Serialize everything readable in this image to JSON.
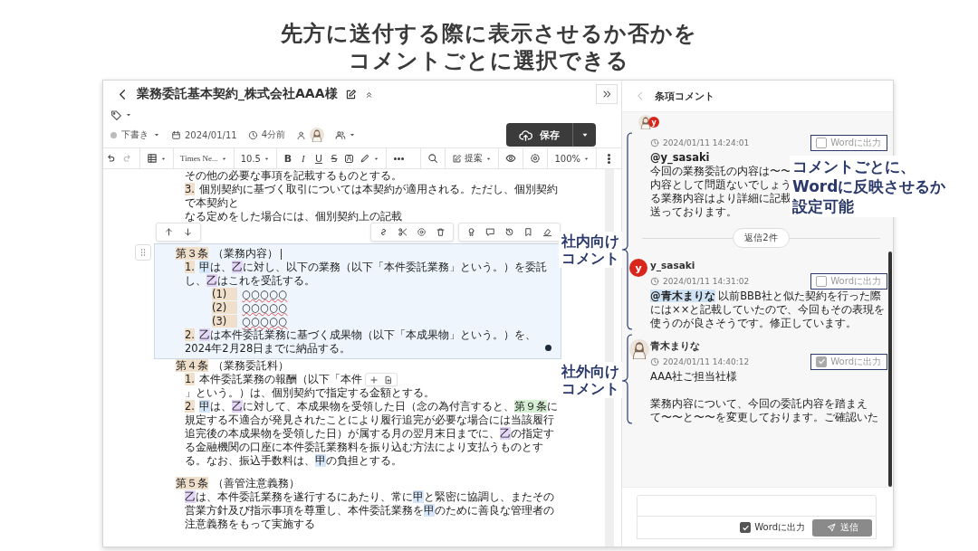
{
  "headline": [
    "先方に送付する際に表示させるか否かを",
    "コメントごとに選択できる"
  ],
  "document": {
    "title": "業務委託基本契約_株式会社AAA様",
    "status": "下書き",
    "date": "2024/01/11",
    "updated": "4分前",
    "save_label": "保存",
    "toolbar": {
      "font": "Times Ne...",
      "size": "10.5",
      "format": [
        {
          "kind": "bold",
          "label": "B"
        },
        {
          "kind": "italic",
          "label": "I"
        },
        {
          "kind": "underline",
          "label": "U"
        },
        {
          "kind": "strike",
          "label": "S"
        },
        {
          "kind": "boxed",
          "label": "A"
        }
      ],
      "mode": "提案",
      "zoom": "100%"
    },
    "lines": [
      {
        "kind": "text",
        "text": "その他の必要な事項を記載するものとする。"
      },
      {
        "kind": "item",
        "segments": [
          {
            "kind": "num",
            "text": "3."
          },
          {
            "kind": "plain",
            "text": "個別契約に基づく取引については本契約が適用される。ただし、個別契約で本契約と"
          }
        ]
      },
      {
        "kind": "text",
        "text": "なる定めをした場合には、個別契約上の記載"
      },
      {
        "kind": "article",
        "selected": true,
        "heading": [
          {
            "kind": "num",
            "text": "第３条"
          },
          {
            "kind": "plain",
            "text": "（業務内容）"
          }
        ],
        "items": [
          {
            "segments": [
              {
                "kind": "num",
                "text": "1."
              },
              {
                "kind": "a",
                "text": "甲"
              },
              {
                "kind": "plain",
                "text": "は、"
              },
              {
                "kind": "b",
                "text": "乙"
              },
              {
                "kind": "plain",
                "text": "に対し、以下の業務（以下「本件委託業務」という。）を委託し、"
              },
              {
                "kind": "b",
                "text": "乙"
              },
              {
                "kind": "plain",
                "text": "はこれを受託する。"
              }
            ],
            "children": [
              {
                "segments": [
                  {
                    "kind": "num",
                    "text": "(1)　"
                  },
                  {
                    "kind": "typo",
                    "text": "○○○○○"
                  }
                ]
              },
              {
                "segments": [
                  {
                    "kind": "num",
                    "text": "(2)　"
                  },
                  {
                    "kind": "typo",
                    "text": "○○○○○"
                  }
                ]
              },
              {
                "segments": [
                  {
                    "kind": "num",
                    "text": "(3)　"
                  },
                  {
                    "kind": "typo",
                    "text": "○○○○○"
                  }
                ]
              }
            ]
          },
          {
            "segments": [
              {
                "kind": "num",
                "text": "2."
              },
              {
                "kind": "b",
                "text": "乙"
              },
              {
                "kind": "plain",
                "text": "は本件委託業務に基づく成果物（以下「本成果物」という。）を、2024年2月28日までに納品する。"
              }
            ]
          }
        ]
      },
      {
        "kind": "article",
        "selected": false,
        "heading": [
          {
            "kind": "num",
            "text": "第４条"
          },
          {
            "kind": "plain",
            "text": "（業務委託料）"
          }
        ],
        "items": [
          {
            "segments": [
              {
                "kind": "num",
                "text": "1."
              },
              {
                "kind": "plain",
                "text": "本件委託業務の報酬（以下「本件"
              }
            ],
            "segments_after": [
              {
                "kind": "plain",
                "text": "」という。）は、個別契約で指定する金額とする。"
              }
            ]
          },
          {
            "segments": [
              {
                "kind": "num",
                "text": "2."
              },
              {
                "kind": "a",
                "text": "甲"
              },
              {
                "kind": "plain",
                "text": "は、"
              },
              {
                "kind": "b",
                "text": "乙"
              },
              {
                "kind": "plain",
                "text": "に対して、本成果物を受領した日（念の為付言すると、"
              },
              {
                "kind": "ref",
                "text": "第９条"
              },
              {
                "kind": "plain",
                "text": "に規定する不適合が発見されたことにより履行追完が必要な場合には当該履行追完後の本成果物を受領した日）が属する月の翌月末日までに、"
              },
              {
                "kind": "b",
                "text": "乙"
              },
              {
                "kind": "plain",
                "text": "の指定する金融機関の口座に本件委託業務料を振り込む方法により支払うものとする。なお、振込手数料は、"
              },
              {
                "kind": "a",
                "text": "甲"
              },
              {
                "kind": "plain",
                "text": "の負担とする。"
              }
            ]
          }
        ]
      },
      {
        "kind": "spacer"
      },
      {
        "kind": "article",
        "selected": false,
        "heading": [
          {
            "kind": "num",
            "text": "第５条"
          },
          {
            "kind": "plain",
            "text": "（善管注意義務）"
          }
        ],
        "items": [
          {
            "segments": [
              {
                "kind": "b",
                "text": "乙"
              },
              {
                "kind": "plain",
                "text": "は、本件委託業務を遂行するにあたり、常に"
              },
              {
                "kind": "a",
                "text": "甲"
              },
              {
                "kind": "plain",
                "text": "と緊密に協調し、またその営業方針及び指示事項を尊重し、本件委託業務を"
              },
              {
                "kind": "a",
                "text": "甲"
              },
              {
                "kind": "plain",
                "text": "のために善良な管理者の注意義務をもって実施する"
              }
            ]
          }
        ]
      }
    ]
  },
  "comments_panel": {
    "title": "条項コメント",
    "avatar_letter": "y",
    "comments": [
      {
        "time": "2024/01/11 14:24:01",
        "word_output": {
          "label": "Wordに出力",
          "checked": false
        },
        "paragraphs": [
          [
            [
              {
                "kind": "handle",
                "text": "@y_sasaki"
              }
            ],
            [
              {
                "kind": "plain",
                "text": "今回の業務委託の内容は〜〜"
              }
            ],
            [
              {
                "kind": "plain",
                "text": "内容として問題ないでしょう"
              }
            ],
            [
              {
                "kind": "plain",
                "text": "る業務内容はより詳細に記載"
              }
            ],
            [
              {
                "kind": "plain",
                "text": "送っております。"
              }
            ]
          ]
        ],
        "replies_label": "返信2件"
      },
      {
        "author": "y_sasaki",
        "avatar": {
          "kind": "letter",
          "letter": "y"
        },
        "time": "2024/01/11 14:31:02",
        "word_output": {
          "label": "Wordに出力",
          "checked": false
        },
        "paragraphs": [
          [
            [
              {
                "kind": "mention",
                "text": "@青木まりな"
              },
              {
                "kind": "plain",
                "text": " 以前BBB社と似た契約を行った際"
              }
            ],
            [
              {
                "kind": "plain",
                "text": "には××と記載していたので、今回もその表現を"
              }
            ],
            [
              {
                "kind": "plain",
                "text": "使うのが良さそうです。修正しています。"
              }
            ]
          ]
        ]
      },
      {
        "author": "青木まりな",
        "avatar": {
          "kind": "photo"
        },
        "time": "2024/01/11 14:40:12",
        "word_output": {
          "label": "Wordに出力",
          "checked": true
        },
        "paragraphs": [
          [
            [
              {
                "kind": "plain",
                "text": "AAA社ご担当社様"
              }
            ]
          ],
          [
            [
              {
                "kind": "plain",
                "text": "業務内容について、今回の委託内容を踏まえ"
              }
            ],
            [
              {
                "kind": "plain",
                "text": "て〜〜と〜〜を変更しております。ご確認いた"
              }
            ]
          ]
        ]
      }
    ],
    "composer": {
      "word_output": {
        "label": "Wordに出力",
        "checked": true
      },
      "send_label": "送信"
    }
  },
  "callouts": [
    {
      "kind": "internal",
      "lines": [
        "社内向け",
        "コメント"
      ]
    },
    {
      "kind": "external",
      "lines": [
        "社外向け",
        "コメント"
      ]
    },
    {
      "kind": "setting",
      "lines": [
        "コメントごとに、",
        "Wordに反映させるか",
        "設定可能"
      ]
    }
  ]
}
